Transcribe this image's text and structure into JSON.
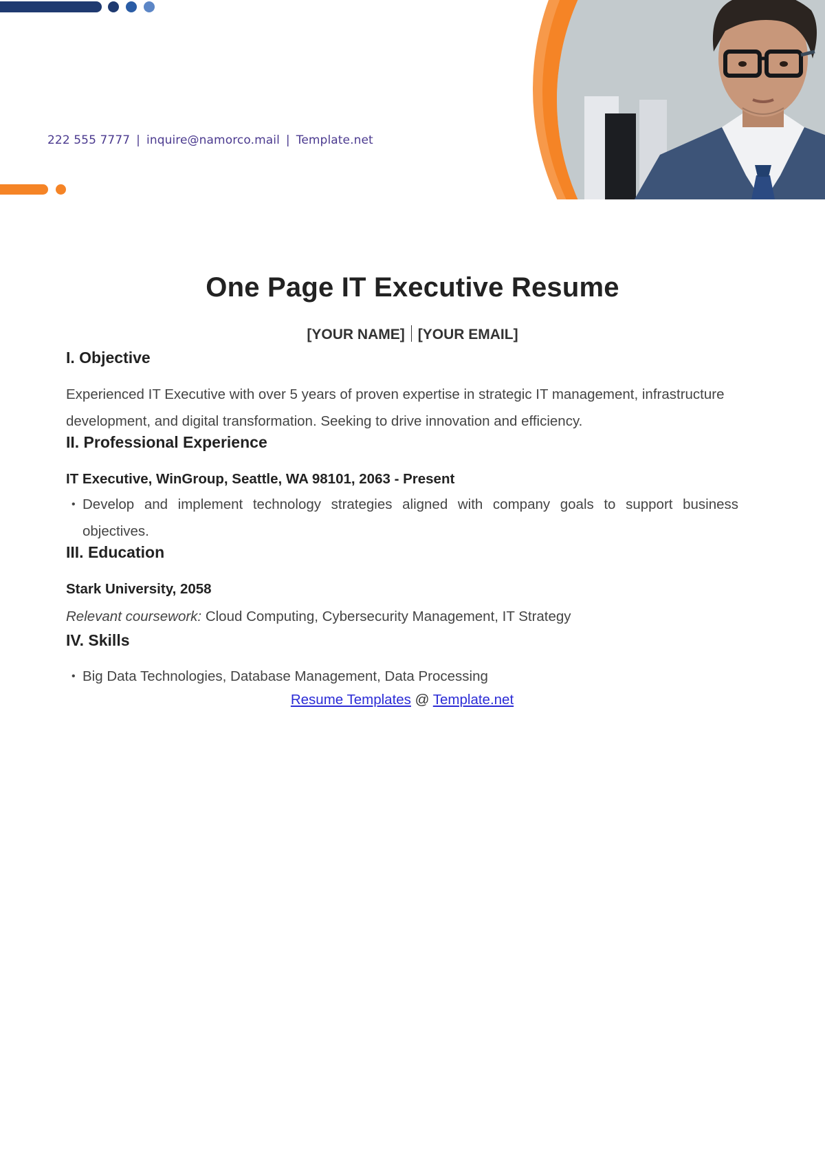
{
  "header": {
    "contact": {
      "phone": "222 555 7777",
      "separator": "|",
      "email": "inquire@namorco.mail",
      "website": "Template.net"
    },
    "photo_alt": "Portrait of man with glasses in office",
    "colors": {
      "navy": "#1f3a70",
      "blue": "#2a5ca5",
      "light_blue": "#5c86c6",
      "orange": "#f58426",
      "light_orange": "#f7994a",
      "contact_text": "#4b3a8f"
    }
  },
  "document": {
    "title": "One Page IT Executive Resume",
    "name_placeholder": "[YOUR NAME]",
    "email_placeholder": "[YOUR EMAIL]",
    "sections": {
      "objective": {
        "heading": "I. Objective",
        "text": "Experienced IT Executive with over 5 years of proven expertise in strategic IT management, infrastructure development, and digital transformation. Seeking to drive innovation and efficiency."
      },
      "experience": {
        "heading": "II. Professional Experience",
        "role": "IT Executive, WinGroup, Seattle, WA 98101, 2063 - Present",
        "bullets": [
          "Develop and implement technology strategies aligned with company goals to support business objectives."
        ]
      },
      "education": {
        "heading": "III. Education",
        "school": "Stark University, 2058",
        "coursework_label": "Relevant coursework:",
        "coursework": " Cloud Computing, Cybersecurity Management, IT Strategy"
      },
      "skills": {
        "heading": "IV. Skills",
        "bullets": [
          "Big Data Technologies, Database Management, Data Processing"
        ]
      }
    },
    "footer": {
      "link1": "Resume Templates",
      "at": " @ ",
      "link2": "Template.net"
    }
  }
}
